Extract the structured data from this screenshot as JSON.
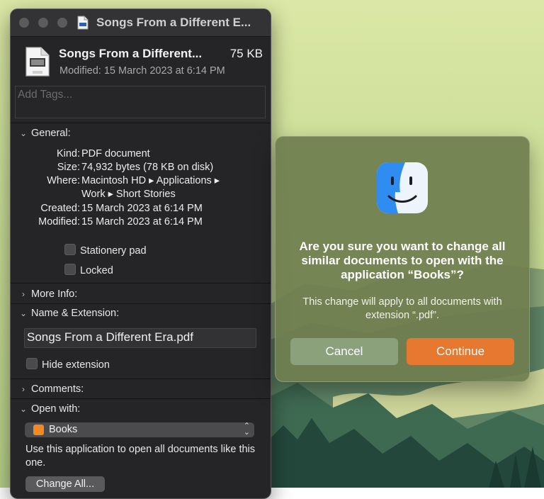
{
  "colors": {
    "accent": "#e6792f",
    "window_bg": "#252527",
    "dialog_bg": "#6f7e4f"
  },
  "info_window": {
    "title": "Songs From a Different E...",
    "file_icon": "pdf-document-icon",
    "file_name": "Songs From a Different...",
    "file_size": "75 KB",
    "modified_header": "Modified: 15 March 2023 at 6:14 PM",
    "tags_placeholder": "Add Tags...",
    "general": {
      "header": "General:",
      "kind_label": "Kind:",
      "kind_value": "PDF document",
      "size_label": "Size:",
      "size_value": "74,932 bytes (78 KB on disk)",
      "where_label": "Where:",
      "where_value_line1": "Macintosh HD ▸ Applications ▸",
      "where_value_line2": "Work ▸ Short Stories",
      "created_label": "Created:",
      "created_value": "15 March 2023 at 6:14 PM",
      "modified_label": "Modified:",
      "modified_value": "15 March 2023 at 6:14 PM",
      "stationery_label": "Stationery pad",
      "locked_label": "Locked"
    },
    "more_info": {
      "header": "More Info:"
    },
    "name_extension": {
      "header": "Name & Extension:",
      "name_value": "Songs From a Different Era.pdf",
      "hide_extension_label": "Hide extension"
    },
    "comments": {
      "header": "Comments:"
    },
    "open_with": {
      "header": "Open with:",
      "app_name": "Books",
      "app_icon": "books-icon",
      "description": "Use this application to open all documents like this one.",
      "change_all_label": "Change All..."
    }
  },
  "dialog": {
    "icon": "finder-icon",
    "heading": "Are you sure you want to change all similar documents to open with the application “Books”?",
    "message": "This change will apply to all documents with extension “.pdf”.",
    "cancel_label": "Cancel",
    "continue_label": "Continue"
  }
}
